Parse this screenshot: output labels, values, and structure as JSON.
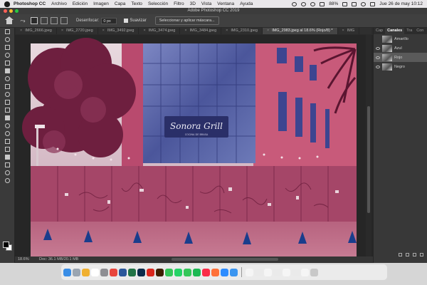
{
  "menubar": {
    "app": "Photoshop CC",
    "items": [
      "Archivo",
      "Edición",
      "Imagen",
      "Capa",
      "Texto",
      "Selección",
      "Filtro",
      "3D",
      "Vista",
      "Ventana",
      "Ayuda"
    ],
    "battery": "88%",
    "datetime": "Jue 26 de may  10:12"
  },
  "window": {
    "title": "Adobe Photoshop CC 2019"
  },
  "options": {
    "desenfocar_label": "Desenfocar:",
    "desenfocar_value": "0 px",
    "suavizar_label": "Suavizar",
    "select_mask_button": "Seleccionar y aplicar máscara..."
  },
  "tabs": [
    "IMG_2666.jpeg",
    "IMG_2720.jpeg",
    "IMG_3492.jpeg",
    "IMG_3474.jpeg",
    "IMG_3484.jpeg",
    "IMG_2310.jpeg",
    "IMG_2983.jpeg al 18.6% (Rojo/8) *",
    "IMG"
  ],
  "active_tab_index": 6,
  "status": {
    "zoom": "18.6%",
    "doc": "Doc: 36.1 MB/20.1 MB"
  },
  "panel": {
    "tabs": [
      "Cap",
      "Canales",
      "Tra",
      "Con"
    ],
    "active_tab_index": 1,
    "channels": [
      {
        "name": "Amarillo",
        "visible": false,
        "selected": false
      },
      {
        "name": "Azul",
        "visible": true,
        "selected": false
      },
      {
        "name": "Rojo",
        "visible": true,
        "selected": true
      },
      {
        "name": "Negro",
        "visible": true,
        "selected": false
      }
    ]
  },
  "canvas_photo": {
    "sign_title": "Sonora Grill",
    "sign_subtitle": "COCINA DE BRASA"
  },
  "colors": {
    "tint": "#b04e74",
    "glass": "#5d6aa8",
    "cone": "#1a3d8c",
    "panel_bg": "#383838"
  }
}
